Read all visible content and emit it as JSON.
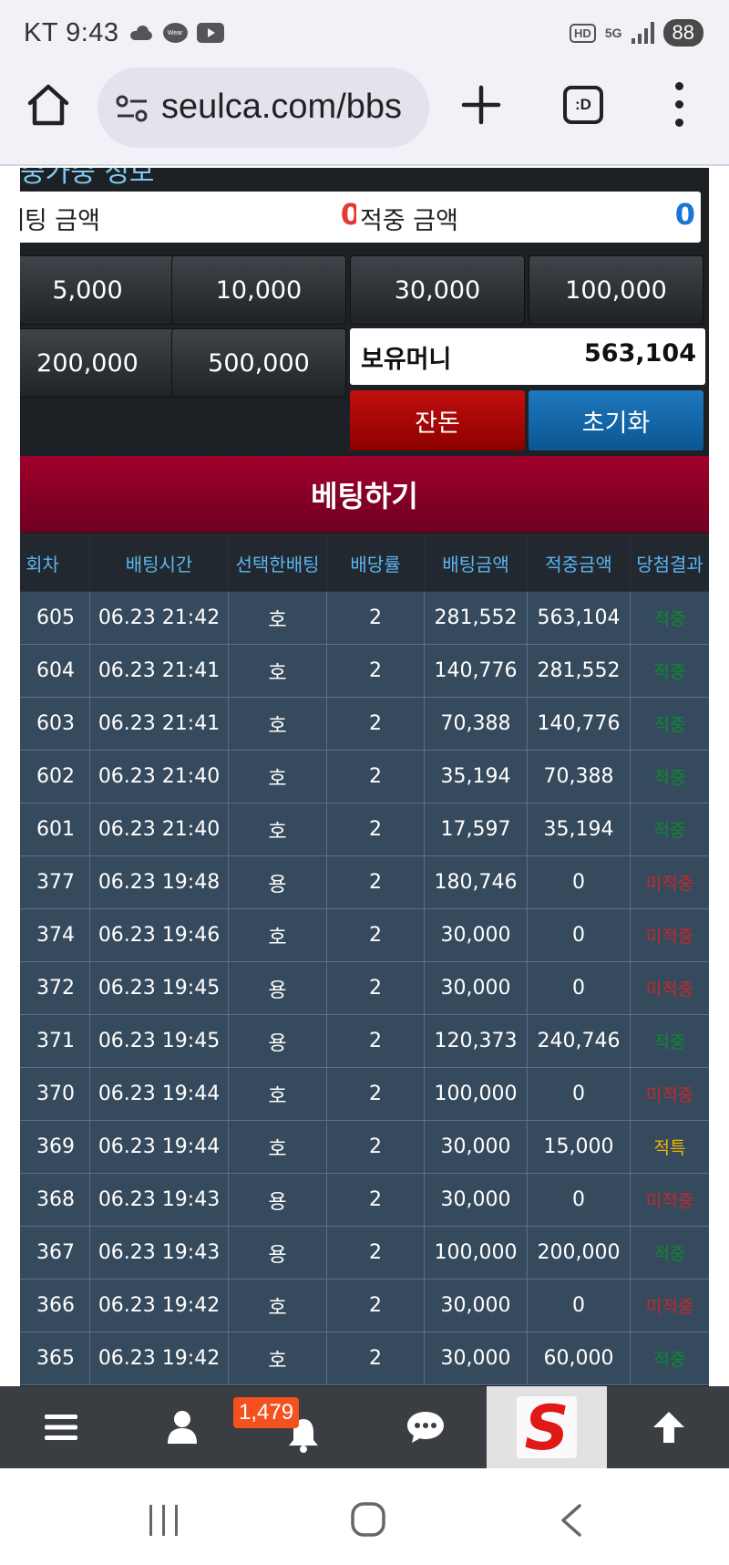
{
  "status_bar": {
    "carrier_time": "KT 9:43",
    "wear_label": "Wear",
    "hd_label": "HD",
    "network_label": "5G",
    "battery": "88"
  },
  "browser": {
    "url": "seulca.com/bbs",
    "tabs_label": ":D"
  },
  "betting_panel": {
    "clipped_heading": "중가중 정보",
    "bet_amount_label": "베팅 금액",
    "bet_amount_value": "0",
    "win_amount_label": "적중 금액",
    "win_amount_value": "0",
    "chips": [
      "5,000",
      "10,000",
      "30,000",
      "100,000",
      "200,000",
      "500,000"
    ],
    "balance_label": "보유머니",
    "balance_value": "563,104",
    "change_button": "잔돈",
    "reset_button": "초기화",
    "place_bet_button": "베팅하기",
    "colors": {
      "bet_value": "#e53935",
      "win_value": "#1976d2"
    }
  },
  "history": {
    "columns": [
      "회차",
      "배팅시간",
      "선택한배팅",
      "배당률",
      "배팅금액",
      "적중금액",
      "당첨결과"
    ],
    "rows": [
      {
        "round": "605",
        "time": "06.23 21:42",
        "pick": "호",
        "odds": "2",
        "bet": "281,552",
        "win": "563,104",
        "result": "적중",
        "status": "win"
      },
      {
        "round": "604",
        "time": "06.23 21:41",
        "pick": "호",
        "odds": "2",
        "bet": "140,776",
        "win": "281,552",
        "result": "적중",
        "status": "win"
      },
      {
        "round": "603",
        "time": "06.23 21:41",
        "pick": "호",
        "odds": "2",
        "bet": "70,388",
        "win": "140,776",
        "result": "적중",
        "status": "win"
      },
      {
        "round": "602",
        "time": "06.23 21:40",
        "pick": "호",
        "odds": "2",
        "bet": "35,194",
        "win": "70,388",
        "result": "적중",
        "status": "win"
      },
      {
        "round": "601",
        "time": "06.23 21:40",
        "pick": "호",
        "odds": "2",
        "bet": "17,597",
        "win": "35,194",
        "result": "적중",
        "status": "win"
      },
      {
        "round": "377",
        "time": "06.23 19:48",
        "pick": "용",
        "odds": "2",
        "bet": "180,746",
        "win": "0",
        "result": "미적중",
        "status": "lose"
      },
      {
        "round": "374",
        "time": "06.23 19:46",
        "pick": "호",
        "odds": "2",
        "bet": "30,000",
        "win": "0",
        "result": "미적중",
        "status": "lose"
      },
      {
        "round": "372",
        "time": "06.23 19:45",
        "pick": "용",
        "odds": "2",
        "bet": "30,000",
        "win": "0",
        "result": "미적중",
        "status": "lose"
      },
      {
        "round": "371",
        "time": "06.23 19:45",
        "pick": "용",
        "odds": "2",
        "bet": "120,373",
        "win": "240,746",
        "result": "적중",
        "status": "win"
      },
      {
        "round": "370",
        "time": "06.23 19:44",
        "pick": "호",
        "odds": "2",
        "bet": "100,000",
        "win": "0",
        "result": "미적중",
        "status": "lose"
      },
      {
        "round": "369",
        "time": "06.23 19:44",
        "pick": "호",
        "odds": "2",
        "bet": "30,000",
        "win": "15,000",
        "result": "적특",
        "status": "special"
      },
      {
        "round": "368",
        "time": "06.23 19:43",
        "pick": "용",
        "odds": "2",
        "bet": "30,000",
        "win": "0",
        "result": "미적중",
        "status": "lose"
      },
      {
        "round": "367",
        "time": "06.23 19:43",
        "pick": "용",
        "odds": "2",
        "bet": "100,000",
        "win": "200,000",
        "result": "적중",
        "status": "win"
      },
      {
        "round": "366",
        "time": "06.23 19:42",
        "pick": "호",
        "odds": "2",
        "bet": "30,000",
        "win": "0",
        "result": "미적중",
        "status": "lose"
      },
      {
        "round": "365",
        "time": "06.23 19:42",
        "pick": "호",
        "odds": "2",
        "bet": "30,000",
        "win": "60,000",
        "result": "적중",
        "status": "win"
      }
    ]
  },
  "bottom_nav": {
    "items": [
      "menu-icon",
      "user-icon",
      "bell-icon",
      "chat-icon",
      "site-logo",
      "arrow-up-icon"
    ],
    "notification_count": "1,479",
    "logo_letter": "S"
  }
}
